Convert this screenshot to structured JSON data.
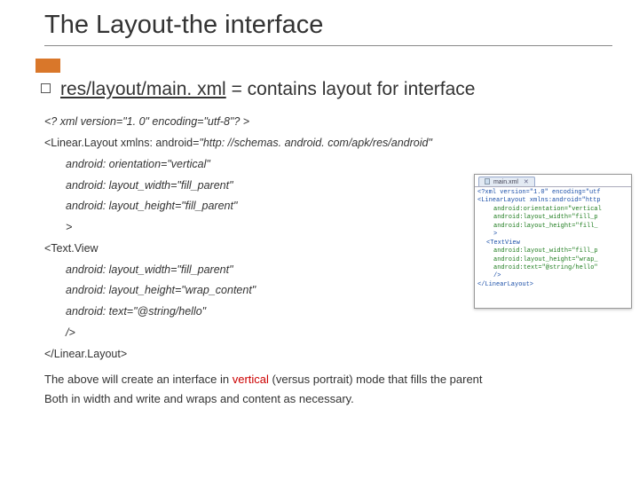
{
  "title": "The Layout-the interface",
  "main": {
    "prefix": "res/layout/main. xml",
    "rest": " = contains layout for interface"
  },
  "code": {
    "l1": "<? xml version=\"1. 0\" encoding=\"utf-8\"? >",
    "l2_a": "<Linear.Layout xmlns: android=",
    "l2_b": "\"http: //schemas. android. com/apk/res/android\"",
    "l3": "android: orientation=\"vertical\"",
    "l4": "android: layout_width=\"fill_parent\"",
    "l5": "android: layout_height=\"fill_parent\"",
    "l6": ">",
    "l7": "<Text.View",
    "l8": "android: layout_width=\"fill_parent\"",
    "l9": "android: layout_height=\"wrap_content\"",
    "l10": "android: text=\"@string/hello\"",
    "l11": "/>",
    "l12": "</Linear.Layout>"
  },
  "footer": {
    "p1a": "The above will create an interface in ",
    "p1b": "vertical",
    "p1c": " (versus portrait) mode that fills the parent",
    "p2": "Both in width and write and wraps and content as necessary."
  },
  "thumb": {
    "tab": "main.xml",
    "lines": [
      "<?xml version=\"1.0\" encoding=\"utf",
      "<LinearLayout  xmlns:android=\"http",
      "android:orientation=\"vertical",
      "android:layout_width=\"fill_p",
      "android:layout_height=\"fill_",
      ">",
      "<TextView",
      "android:layout_width=\"fill_p",
      "android:layout_height=\"wrap_",
      "android:text=\"@string/hello\"",
      "/>",
      "</LinearLayout>"
    ]
  }
}
